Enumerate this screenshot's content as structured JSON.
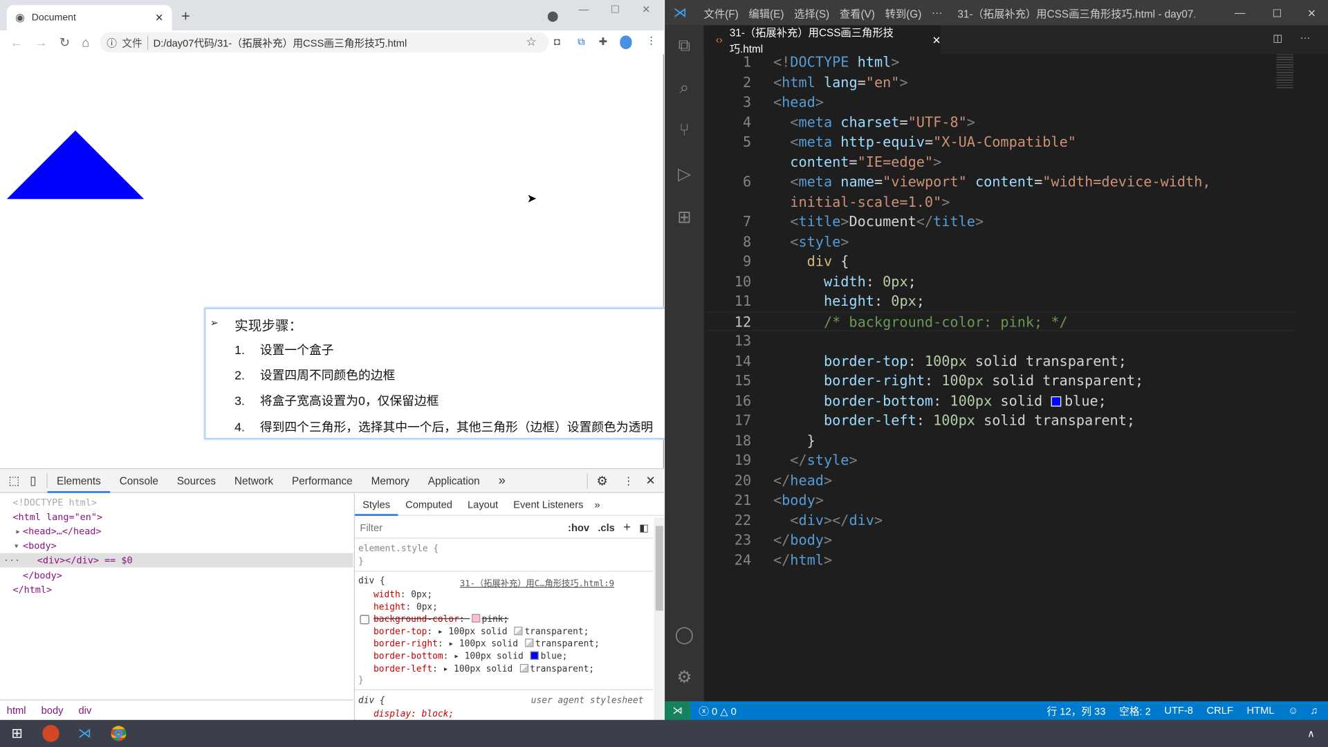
{
  "browser": {
    "tab_title": "Document",
    "new_tab": "+",
    "file_label": "文件",
    "url": "D:/day07代码/31-（拓展补充）用CSS画三角形技巧.html",
    "shape_color": "#0000ff"
  },
  "slide": {
    "heading": "实现步骤：",
    "steps": [
      {
        "num": "1.",
        "text": "设置一个盒子"
      },
      {
        "num": "2.",
        "text": "设置四周不同颜色的边框"
      },
      {
        "num": "3.",
        "text": "将盒子宽高设置为0，仅保留边框"
      },
      {
        "num": "4.",
        "text": "得到四个三角形，选择其中一个后，其他三角形（边框）设置颜色为透明"
      }
    ]
  },
  "devtools": {
    "tabs": [
      "Elements",
      "Console",
      "Sources",
      "Network",
      "Performance",
      "Memory",
      "Application"
    ],
    "more": "»",
    "dom": [
      "<!DOCTYPE html>",
      "<html lang=\"en\">",
      "<head>…</head>",
      "<body>",
      "<div></div> == $0",
      "</body>",
      "</html>"
    ],
    "style_tabs": [
      "Styles",
      "Computed",
      "Layout",
      "Event Listeners"
    ],
    "filter_placeholder": "Filter",
    "hov": ":hov",
    "cls": ".cls",
    "plus": "+",
    "element_style": "element.style {",
    "close_brace": "}",
    "rule_selector": "div {",
    "rule_source": "31-（拓展补充）用C…角形技巧.html:9",
    "props": [
      {
        "name": "width",
        "value": "0px;"
      },
      {
        "name": "height",
        "value": "0px;"
      },
      {
        "name": "background-color",
        "value": "pink;",
        "swatch": "#ffc0cb",
        "disabled": true
      },
      {
        "name": "border-top",
        "value": "100px solid",
        "swatch": "transparent",
        "tail": "transparent;"
      },
      {
        "name": "border-right",
        "value": "100px solid",
        "swatch": "transparent",
        "tail": "transparent;"
      },
      {
        "name": "border-bottom",
        "value": "100px solid",
        "swatch": "#0000ff",
        "tail": "blue;"
      },
      {
        "name": "border-left",
        "value": "100px solid",
        "swatch": "transparent",
        "tail": "transparent;"
      }
    ],
    "ua_selector": "div {",
    "ua_label": "user agent stylesheet",
    "ua_prop": "display: block;",
    "breadcrumbs": [
      "html",
      "body",
      "div"
    ]
  },
  "vscode": {
    "menu": [
      "文件(F)",
      "编辑(E)",
      "选择(S)",
      "查看(V)",
      "转到(G)",
      "···"
    ],
    "window_title": "31-（拓展补充）用CSS画三角形技巧.html - day07...",
    "tab_title": "31-（拓展补充）用CSS画三角形技巧.html",
    "current_line": 12,
    "code": [
      {
        "n": "1",
        "t": [
          [
            "<!",
            "b"
          ],
          [
            "DOCTYPE",
            "tag"
          ],
          [
            " html",
            "at"
          ],
          [
            ">",
            "b"
          ]
        ]
      },
      {
        "n": "2",
        "t": [
          [
            "<",
            "b"
          ],
          [
            "html",
            "tag"
          ],
          [
            " lang",
            "at"
          ],
          [
            "=",
            "x"
          ],
          [
            "\"en\"",
            "s"
          ],
          [
            ">",
            "b"
          ]
        ]
      },
      {
        "n": "3",
        "t": [
          [
            "<",
            "b"
          ],
          [
            "head",
            "tag"
          ],
          [
            ">",
            "b"
          ]
        ]
      },
      {
        "n": "4",
        "t": [
          [
            "  <",
            "b"
          ],
          [
            "meta",
            "tag"
          ],
          [
            " charset",
            "at"
          ],
          [
            "=",
            "x"
          ],
          [
            "\"UTF-8\"",
            "s"
          ],
          [
            ">",
            "b"
          ]
        ]
      },
      {
        "n": "5",
        "t": [
          [
            "  <",
            "b"
          ],
          [
            "meta",
            "tag"
          ],
          [
            " http-equiv",
            "at"
          ],
          [
            "=",
            "x"
          ],
          [
            "\"X-UA-Compatible\"",
            "s"
          ]
        ]
      },
      {
        "n": "",
        "t": [
          [
            "  content",
            "at"
          ],
          [
            "=",
            "x"
          ],
          [
            "\"IE=edge\"",
            "s"
          ],
          [
            ">",
            "b"
          ]
        ]
      },
      {
        "n": "6",
        "t": [
          [
            "  <",
            "b"
          ],
          [
            "meta",
            "tag"
          ],
          [
            " name",
            "at"
          ],
          [
            "=",
            "x"
          ],
          [
            "\"viewport\"",
            "s"
          ],
          [
            " content",
            "at"
          ],
          [
            "=",
            "x"
          ],
          [
            "\"width=device-width,",
            "s"
          ]
        ]
      },
      {
        "n": "",
        "t": [
          [
            "  initial-scale=1.0\"",
            "s"
          ],
          [
            ">",
            "b"
          ]
        ]
      },
      {
        "n": "7",
        "t": [
          [
            "  <",
            "b"
          ],
          [
            "title",
            "tag"
          ],
          [
            ">",
            "b"
          ],
          [
            "Document",
            "x"
          ],
          [
            "</",
            "b"
          ],
          [
            "title",
            "tag"
          ],
          [
            ">",
            "b"
          ]
        ]
      },
      {
        "n": "8",
        "t": [
          [
            "  <",
            "b"
          ],
          [
            "style",
            "tag"
          ],
          [
            ">",
            "b"
          ]
        ]
      },
      {
        "n": "9",
        "t": [
          [
            "    div",
            "sel"
          ],
          [
            " {",
            "x"
          ]
        ]
      },
      {
        "n": "10",
        "t": [
          [
            "      width",
            "p"
          ],
          [
            ": ",
            "x"
          ],
          [
            "0px",
            "n"
          ],
          [
            ";",
            "x"
          ]
        ]
      },
      {
        "n": "11",
        "t": [
          [
            "      height",
            "p"
          ],
          [
            ": ",
            "x"
          ],
          [
            "0px",
            "n"
          ],
          [
            ";",
            "x"
          ]
        ]
      },
      {
        "n": "12",
        "t": [
          [
            "      /* background-color: pink; */",
            "c"
          ]
        ]
      },
      {
        "n": "13",
        "t": []
      },
      {
        "n": "14",
        "t": [
          [
            "      border-top",
            "p"
          ],
          [
            ": ",
            "x"
          ],
          [
            "100px",
            "n"
          ],
          [
            " solid transparent;",
            "x"
          ]
        ]
      },
      {
        "n": "15",
        "t": [
          [
            "      border-right",
            "p"
          ],
          [
            ": ",
            "x"
          ],
          [
            "100px",
            "n"
          ],
          [
            " solid transparent;",
            "x"
          ]
        ]
      },
      {
        "n": "16",
        "t": [
          [
            "      border-bottom",
            "p"
          ],
          [
            ": ",
            "x"
          ],
          [
            "100px",
            "n"
          ],
          [
            " solid ",
            "x"
          ],
          [
            "",
            "sw"
          ],
          [
            "blue;",
            "x"
          ]
        ]
      },
      {
        "n": "17",
        "t": [
          [
            "      border-left",
            "p"
          ],
          [
            ": ",
            "x"
          ],
          [
            "100px",
            "n"
          ],
          [
            " solid transparent;",
            "x"
          ]
        ]
      },
      {
        "n": "18",
        "t": [
          [
            "    }",
            "x"
          ]
        ]
      },
      {
        "n": "19",
        "t": [
          [
            "  </",
            "b"
          ],
          [
            "style",
            "tag"
          ],
          [
            ">",
            "b"
          ]
        ]
      },
      {
        "n": "20",
        "t": [
          [
            "</",
            "b"
          ],
          [
            "head",
            "tag"
          ],
          [
            ">",
            "b"
          ]
        ]
      },
      {
        "n": "21",
        "t": [
          [
            "<",
            "b"
          ],
          [
            "body",
            "tag"
          ],
          [
            ">",
            "b"
          ]
        ]
      },
      {
        "n": "22",
        "t": [
          [
            "  <",
            "b"
          ],
          [
            "div",
            "tag"
          ],
          [
            "></",
            "b"
          ],
          [
            "div",
            "tag"
          ],
          [
            ">",
            "b"
          ]
        ]
      },
      {
        "n": "23",
        "t": [
          [
            "</",
            "b"
          ],
          [
            "body",
            "tag"
          ],
          [
            ">",
            "b"
          ]
        ]
      },
      {
        "n": "24",
        "t": [
          [
            "</",
            "b"
          ],
          [
            "html",
            "tag"
          ],
          [
            ">",
            "b"
          ]
        ]
      }
    ],
    "status": {
      "errors": "0",
      "warnings": "0",
      "position": "行 12，列 33",
      "spaces": "空格: 2",
      "encoding": "UTF-8",
      "eol": "CRLF",
      "language": "HTML"
    },
    "accent": "#007acc"
  }
}
